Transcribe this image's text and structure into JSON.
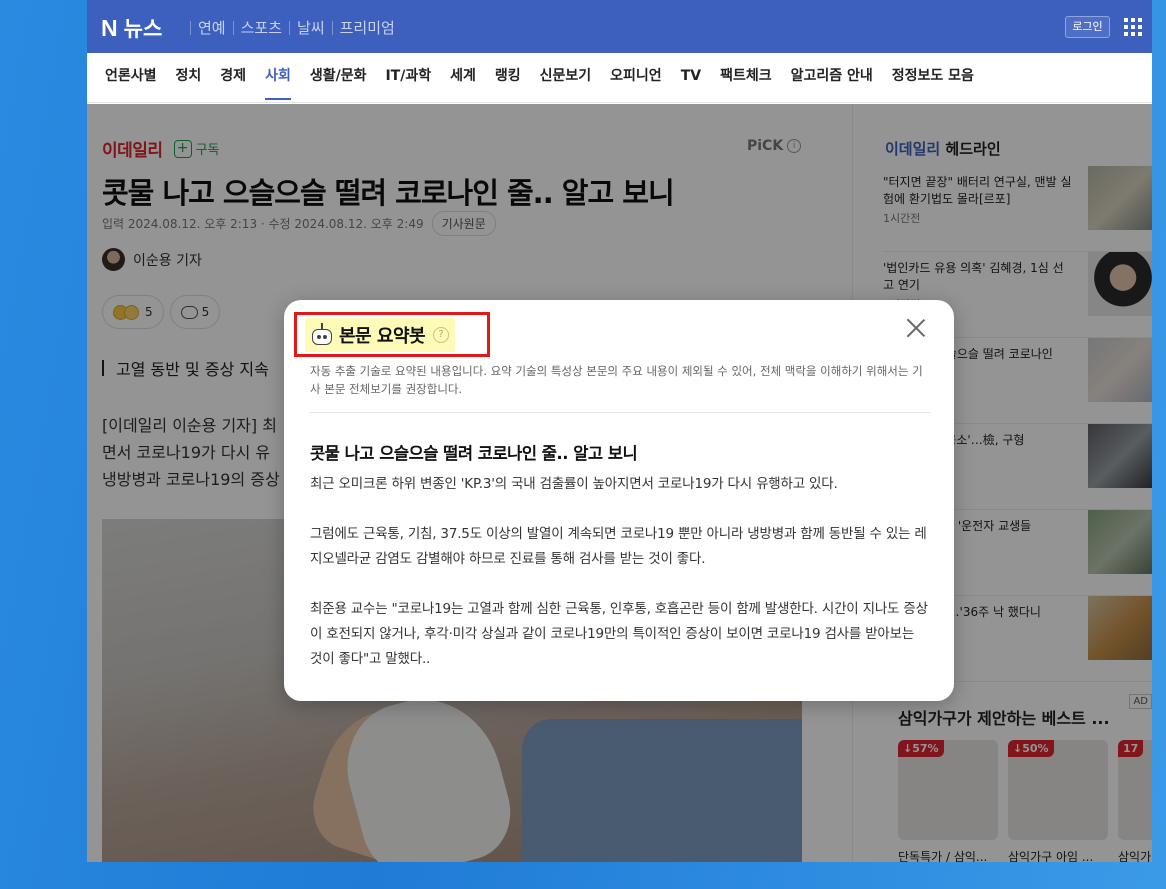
{
  "header": {
    "logo_n": "N",
    "logo_text": "뉴스",
    "top_nav": [
      "연예",
      "스포츠",
      "날씨",
      "프리미엄"
    ],
    "login_label": "로그인"
  },
  "category_nav": {
    "items": [
      "언론사별",
      "정치",
      "경제",
      "사회",
      "생활/문화",
      "IT/과학",
      "세계",
      "랭킹",
      "신문보기",
      "오피니언",
      "TV",
      "팩트체크",
      "알고리즘 안내",
      "정정보도 모음"
    ],
    "active": "사회"
  },
  "article": {
    "press": "이데일리",
    "subscribe_plus": "+",
    "subscribe_label": "구독",
    "pick_label": "PiCK",
    "pick_info": "i",
    "headline": "콧물 나고 으슬으슬 떨려 코로나인 줄.. 알고 보니",
    "dates": "입력 2024.08.12. 오후 2:13 · 수정 2024.08.12. 오후 2:49",
    "original_label": "기사원문",
    "reporter": "이순용 기자",
    "reaction_count": "5",
    "comment_count": "5",
    "summary_line": "고열 동반 및 증상 지속",
    "body_lines": [
      "[이데일리 이순용 기자] 최",
      "면서 코로나19가 다시 유",
      "냉방병과 코로나19의 증상"
    ]
  },
  "sidebar": {
    "title_press": "이데일리",
    "title_suffix": " 헤드라인",
    "items": [
      {
        "text": "\"터지면 끝장\" 배터리 연구실, 맨발 실험에 환기법도 몰라[르포]",
        "time": "1시간전"
      },
      {
        "text": "'법인카드 유용 의혹' 김혜경, 1심 선고 연기",
        "time": "1시간전"
      },
      {
        "text": "콧물 나고 으슬으슬 떨려 코로나인 줄..",
        "time": ""
      },
      {
        "text": "훼손 '탈덕수용소'…檢, 구형",
        "time": ""
      },
      {
        "text": "…차 뒤집히자 '운전자 교생들",
        "time": ""
      },
      {
        "text": "동원해 징계\"…'36주 낙 했다니",
        "time": ""
      }
    ],
    "ad_title": "삼익가구가 제안하는 베스트 ...",
    "ad_badge": "AD",
    "products": [
      {
        "discount": "↓57%",
        "name": "단독특가 / 삼익..."
      },
      {
        "discount": "↓50%",
        "name": "삼익가구 아임 ..."
      },
      {
        "discount": "17",
        "name": "삼익가"
      }
    ]
  },
  "modal": {
    "title": "본문 요약봇",
    "help": "?",
    "notice": "자동 추출 기술로 요약된 내용입니다. 요약 기술의 특성상 본문의 주요 내용이 제외될 수 있어, 전체 맥락을 이해하기 위해서는 기사 본문 전체보기를 권장합니다.",
    "summary_title": "콧물 나고 으슬으슬 떨려 코로나인 줄.. 알고 보니",
    "paragraphs": [
      "최근 오미크론 하위 변종인 'KP.3'의 국내 검출률이 높아지면서 코로나19가 다시 유행하고 있다.",
      "그럼에도 근육통, 기침, 37.5도 이상의 발열이 계속되면 코로나19 뿐만 아니라 냉방병과 함께 동반될 수 있는 레지오넬라균 감염도 감별해야 하므로 진료를 통해 검사를 받는 것이 좋다.",
      "최준용 교수는 \"코로나19는 고열과 함께 심한 근육통, 인후통, 호흡곤란 등이 함께 발생한다. 시간이 지나도 증상이 호전되지 않거나, 후각·미각 상실과 같이 코로나19만의 특이적인 증상이 보이면 코로나19 검사를 받아보는 것이 좋다\"고 말했다.."
    ]
  },
  "colors": {
    "brand_blue": "#3d5fbd",
    "press_red": "#e0242f",
    "subscribe_green": "#1fa24a",
    "highlight_box": "#e31818",
    "highlight_fill": "#fdfbb7"
  }
}
